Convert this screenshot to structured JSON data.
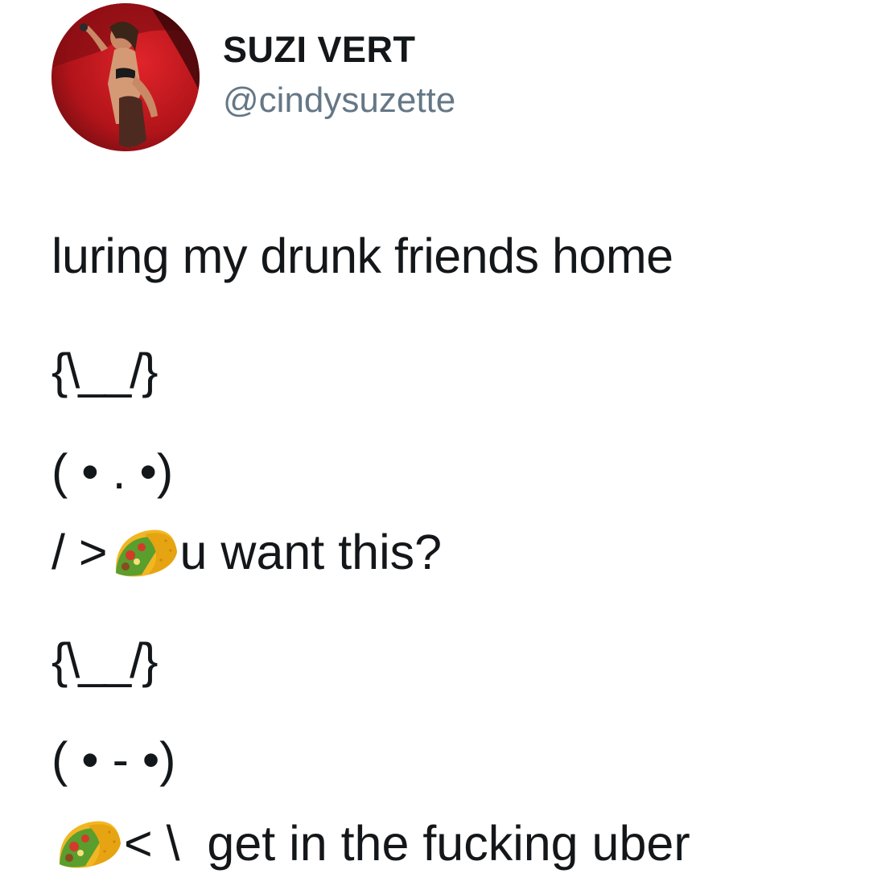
{
  "profile": {
    "display_name": "SUZI VERT",
    "handle": "@cindysuzette"
  },
  "tweet": {
    "line1": "luring my drunk friends home",
    "line2": "{\\__/}",
    "line3": "( • . •)",
    "line4_prefix": "/ >",
    "line4_emoji": "taco-emoji",
    "line4_suffix": "u want this?",
    "line5": "{\\__/}",
    "line6": "( • - •)",
    "line7_emoji": "taco-emoji",
    "line7_suffix": "< \\  get in the fucking uber"
  },
  "colors": {
    "text": "#14171a",
    "handle": "#657786",
    "avatar_bg": "#b5161b"
  }
}
